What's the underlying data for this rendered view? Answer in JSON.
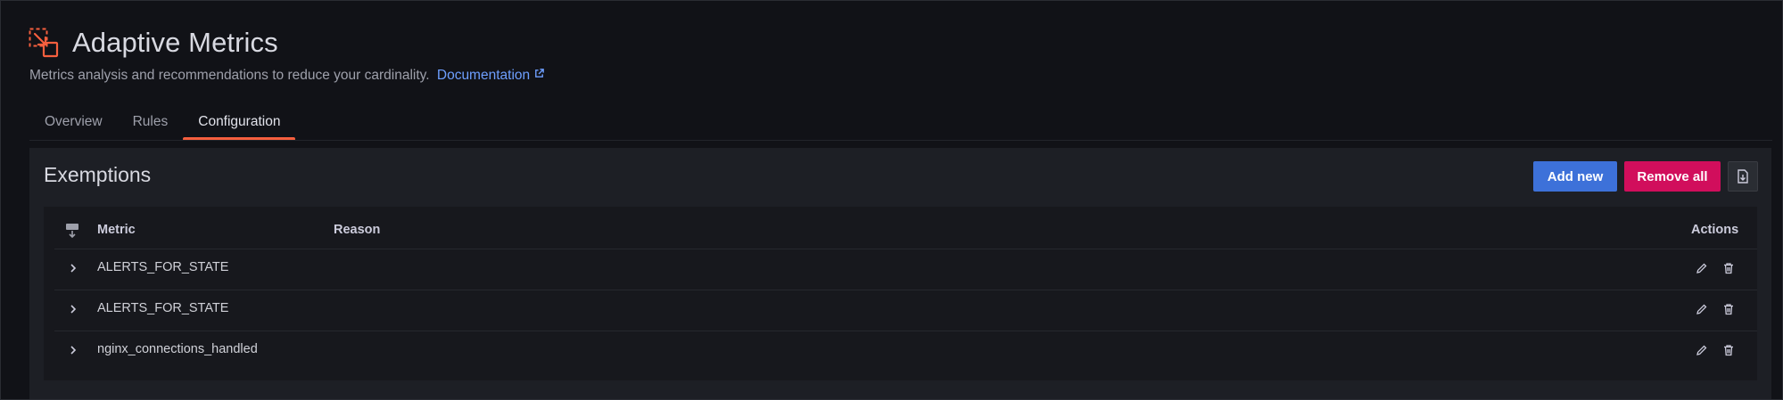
{
  "app": {
    "title": "Adaptive Metrics",
    "subtitle": "Metrics analysis and recommendations to reduce your cardinality.",
    "doc_link": "Documentation",
    "accent": "#f55f3e",
    "icon": "resize-arrow-icon"
  },
  "tabs": [
    {
      "label": "Overview",
      "active": false
    },
    {
      "label": "Rules",
      "active": false
    },
    {
      "label": "Configuration",
      "active": true
    }
  ],
  "panel": {
    "title": "Exemptions",
    "add_label": "Add new",
    "remove_label": "Remove all",
    "export_icon": "file-export-icon"
  },
  "table": {
    "columns": {
      "metric": "Metric",
      "reason": "Reason",
      "actions": "Actions"
    },
    "rows": [
      {
        "metric": "ALERTS_FOR_STATE",
        "reason": ""
      },
      {
        "metric": "ALERTS_FOR_STATE",
        "reason": ""
      },
      {
        "metric": "nginx_connections_handled",
        "reason": ""
      }
    ]
  },
  "colors": {
    "primary": "#3d71d9",
    "destructive": "#d10e5c",
    "link": "#6e9fff"
  }
}
